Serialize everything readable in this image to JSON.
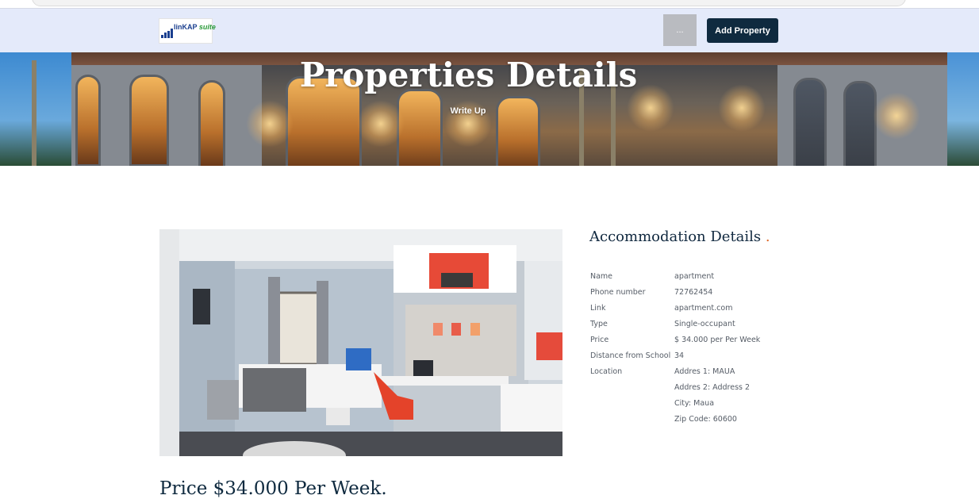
{
  "navbar": {
    "logo_text": "linKAP",
    "logo_sub": "suite",
    "menu_label": "...",
    "add_property_label": "Add Property"
  },
  "hero": {
    "title": "Properties Details",
    "subtitle": "Write Up"
  },
  "accommodation": {
    "heading": "Accommodation Details",
    "heading_dot": ".",
    "rows": [
      {
        "label": "Name",
        "value": "apartment"
      },
      {
        "label": "Phone number",
        "value": "72762454"
      },
      {
        "label": "Link",
        "value": "apartment.com"
      },
      {
        "label": "Type",
        "value": "Single-occupant"
      },
      {
        "label": "Price",
        "value": "$ 34.000 per Per Week"
      },
      {
        "label": "Distance from School",
        "value": "34"
      },
      {
        "label": "Location",
        "value": "Addres 1: MAUA"
      },
      {
        "label": "",
        "value": "Addres 2: Address 2"
      },
      {
        "label": "",
        "value": "City: Maua"
      },
      {
        "label": "",
        "value": "Zip Code: 60600"
      }
    ]
  },
  "price_line": "Price $34.000 Per Week."
}
